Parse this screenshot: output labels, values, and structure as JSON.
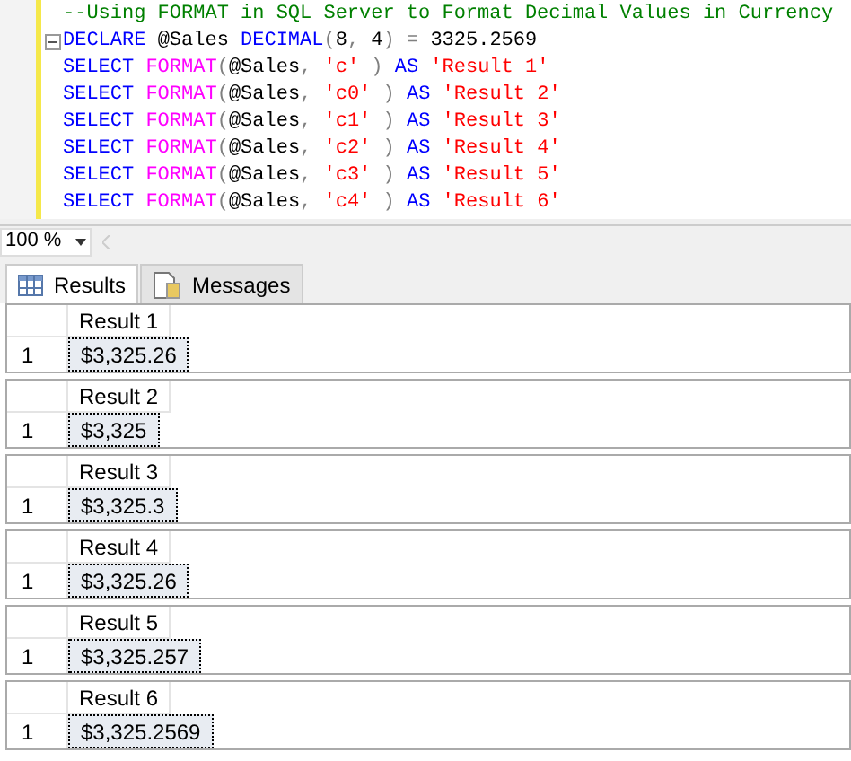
{
  "editor": {
    "lines": [
      {
        "collapse": false,
        "tokens": [
          {
            "kind": "comment",
            "text": "--Using FORMAT in SQL Server to Format Decimal Values in Currency"
          }
        ]
      },
      {
        "collapse": true,
        "tokens": [
          {
            "kind": "keyword",
            "text": "DECLARE"
          },
          {
            "kind": "plain",
            "text": " @Sales "
          },
          {
            "kind": "keyword",
            "text": "DECIMAL"
          },
          {
            "kind": "operator",
            "text": "("
          },
          {
            "kind": "plain",
            "text": "8"
          },
          {
            "kind": "operator",
            "text": ","
          },
          {
            "kind": "plain",
            "text": " 4"
          },
          {
            "kind": "operator",
            "text": ")"
          },
          {
            "kind": "operator",
            "text": " ="
          },
          {
            "kind": "plain",
            "text": " 3325.2569"
          }
        ]
      },
      {
        "collapse": false,
        "tokens": [
          {
            "kind": "keyword",
            "text": "SELECT"
          },
          {
            "kind": "function",
            "text": " FORMAT"
          },
          {
            "kind": "operator",
            "text": "("
          },
          {
            "kind": "plain",
            "text": "@Sales"
          },
          {
            "kind": "operator",
            "text": ","
          },
          {
            "kind": "string",
            "text": " 'c'"
          },
          {
            "kind": "operator",
            "text": " )"
          },
          {
            "kind": "keyword",
            "text": " AS"
          },
          {
            "kind": "string",
            "text": " 'Result 1'"
          }
        ]
      },
      {
        "collapse": false,
        "tokens": [
          {
            "kind": "keyword",
            "text": "SELECT"
          },
          {
            "kind": "function",
            "text": " FORMAT"
          },
          {
            "kind": "operator",
            "text": "("
          },
          {
            "kind": "plain",
            "text": "@Sales"
          },
          {
            "kind": "operator",
            "text": ","
          },
          {
            "kind": "string",
            "text": " 'c0'"
          },
          {
            "kind": "operator",
            "text": " )"
          },
          {
            "kind": "keyword",
            "text": " AS"
          },
          {
            "kind": "string",
            "text": " 'Result 2'"
          }
        ]
      },
      {
        "collapse": false,
        "tokens": [
          {
            "kind": "keyword",
            "text": "SELECT"
          },
          {
            "kind": "function",
            "text": " FORMAT"
          },
          {
            "kind": "operator",
            "text": "("
          },
          {
            "kind": "plain",
            "text": "@Sales"
          },
          {
            "kind": "operator",
            "text": ","
          },
          {
            "kind": "string",
            "text": " 'c1'"
          },
          {
            "kind": "operator",
            "text": " )"
          },
          {
            "kind": "keyword",
            "text": " AS"
          },
          {
            "kind": "string",
            "text": " 'Result 3'"
          }
        ]
      },
      {
        "collapse": false,
        "tokens": [
          {
            "kind": "keyword",
            "text": "SELECT"
          },
          {
            "kind": "function",
            "text": " FORMAT"
          },
          {
            "kind": "operator",
            "text": "("
          },
          {
            "kind": "plain",
            "text": "@Sales"
          },
          {
            "kind": "operator",
            "text": ","
          },
          {
            "kind": "string",
            "text": " 'c2'"
          },
          {
            "kind": "operator",
            "text": " )"
          },
          {
            "kind": "keyword",
            "text": " AS"
          },
          {
            "kind": "string",
            "text": " 'Result 4'"
          }
        ]
      },
      {
        "collapse": false,
        "tokens": [
          {
            "kind": "keyword",
            "text": "SELECT"
          },
          {
            "kind": "function",
            "text": " FORMAT"
          },
          {
            "kind": "operator",
            "text": "("
          },
          {
            "kind": "plain",
            "text": "@Sales"
          },
          {
            "kind": "operator",
            "text": ","
          },
          {
            "kind": "string",
            "text": " 'c3'"
          },
          {
            "kind": "operator",
            "text": " )"
          },
          {
            "kind": "keyword",
            "text": " AS"
          },
          {
            "kind": "string",
            "text": " 'Result 5'"
          }
        ]
      },
      {
        "collapse": false,
        "tokens": [
          {
            "kind": "keyword",
            "text": "SELECT"
          },
          {
            "kind": "function",
            "text": " FORMAT"
          },
          {
            "kind": "operator",
            "text": "("
          },
          {
            "kind": "plain",
            "text": "@Sales"
          },
          {
            "kind": "operator",
            "text": ","
          },
          {
            "kind": "string",
            "text": " 'c4'"
          },
          {
            "kind": "operator",
            "text": " )"
          },
          {
            "kind": "keyword",
            "text": " AS"
          },
          {
            "kind": "string",
            "text": " 'Result 6'"
          }
        ]
      }
    ]
  },
  "zoom": {
    "value": "100 %"
  },
  "tabs": [
    {
      "label": "Results",
      "selected": true
    },
    {
      "label": "Messages",
      "selected": false
    }
  ],
  "results": [
    {
      "column": "Result 1",
      "rows": [
        {
          "number": "1",
          "value": "$3,325.26",
          "selected": true
        }
      ]
    },
    {
      "column": "Result 2",
      "rows": [
        {
          "number": "1",
          "value": "$3,325",
          "selected": true
        }
      ]
    },
    {
      "column": "Result 3",
      "rows": [
        {
          "number": "1",
          "value": "$3,325.3",
          "selected": true
        }
      ]
    },
    {
      "column": "Result 4",
      "rows": [
        {
          "number": "1",
          "value": "$3,325.26",
          "selected": true
        }
      ]
    },
    {
      "column": "Result 5",
      "rows": [
        {
          "number": "1",
          "value": "$3,325.257",
          "selected": true
        }
      ]
    },
    {
      "column": "Result 6",
      "rows": [
        {
          "number": "1",
          "value": "$3,325.2569",
          "selected": true
        }
      ]
    }
  ]
}
